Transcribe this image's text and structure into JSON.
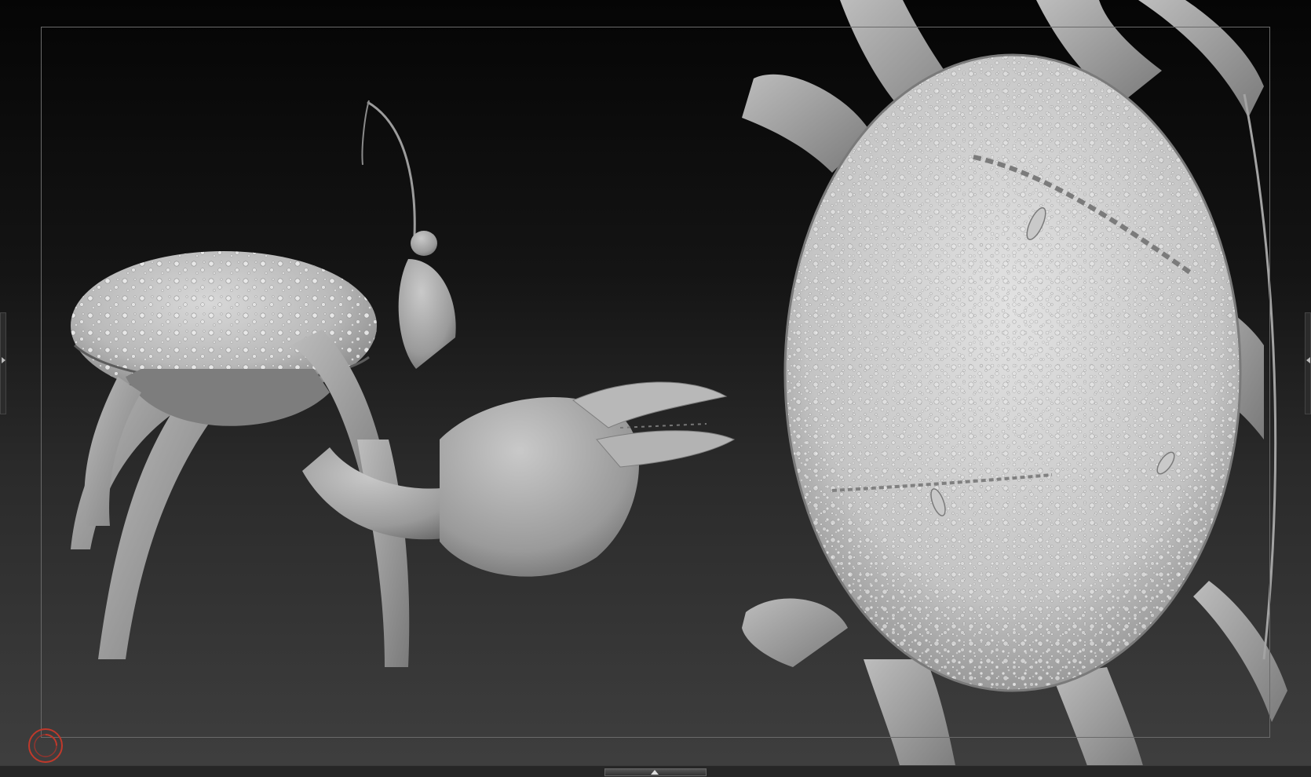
{
  "app": {
    "accent": "#c0392b",
    "clay_color": "#a9a9a9"
  },
  "viewport": {
    "background_top": "#050505",
    "background_bottom": "#3f3f3f"
  },
  "icons": {
    "left_panel_toggle": "chevron-left-icon",
    "right_panel_toggle": "chevron-right-icon",
    "bottom_panel_toggle": "chevron-up-icon",
    "record_indicator": "record-circle-icon"
  }
}
